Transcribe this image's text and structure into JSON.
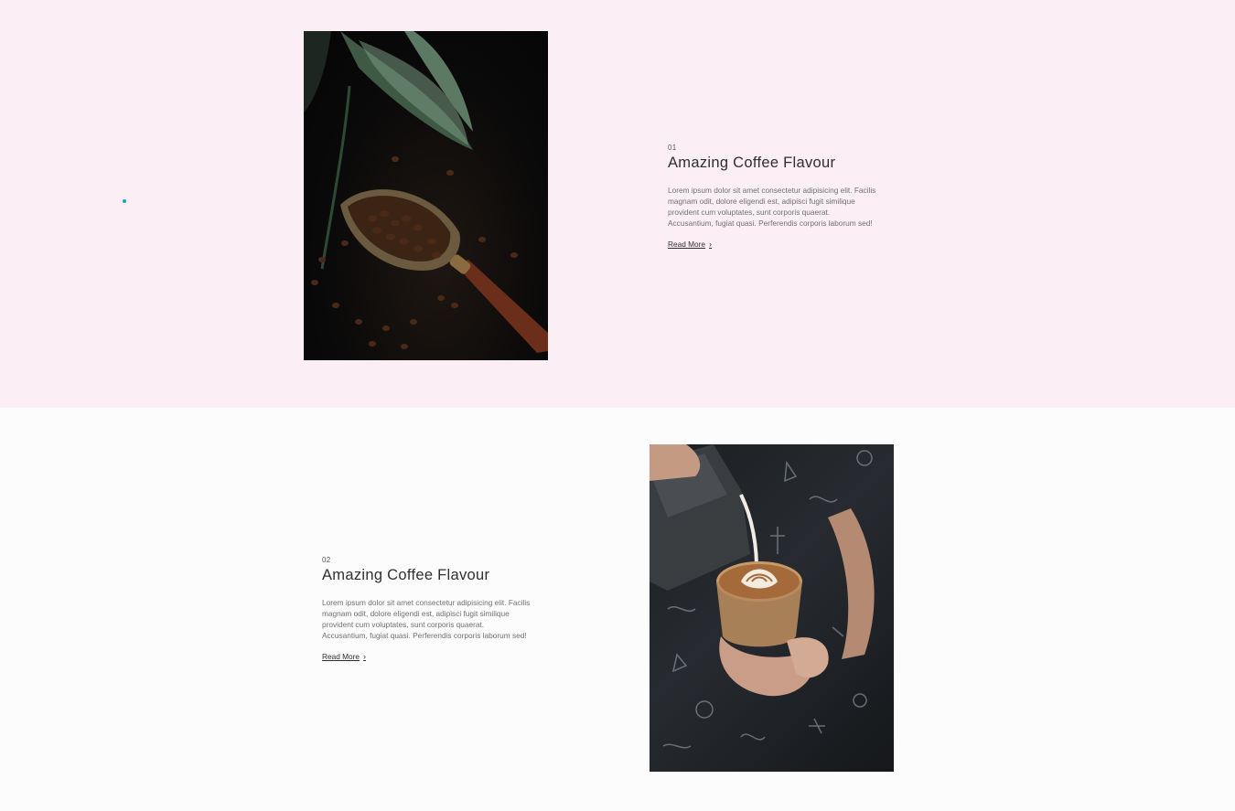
{
  "features": [
    {
      "number": "01",
      "title": "Amazing Coffee Flavour",
      "description": "Lorem ipsum dolor sit amet consectetur adipisicing elit. Facilis magnam odit, dolore eligendi est, adipisci fugit similique provident cum voluptates, sunt corporis quaerat. Accusantium, fugiat quasi. Perferendis corporis laborum sed!",
      "link_label": "Read More",
      "link_icon": "chevron-right-icon"
    },
    {
      "number": "02",
      "title": "Amazing Coffee Flavour",
      "description": "Lorem ipsum dolor sit amet consectetur adipisicing elit. Facilis magnam odit, dolore eligendi est, adipisci fugit similique provident cum voluptates, sunt corporis quaerat. Accusantium, fugiat quasi. Perferendis corporis laborum sed!",
      "link_label": "Read More",
      "link_icon": "chevron-right-icon"
    }
  ],
  "colors": {
    "section_1_bg": "#fbeff5",
    "section_2_bg": "#fdfcfd",
    "accent_dot": "#17a5c7"
  }
}
